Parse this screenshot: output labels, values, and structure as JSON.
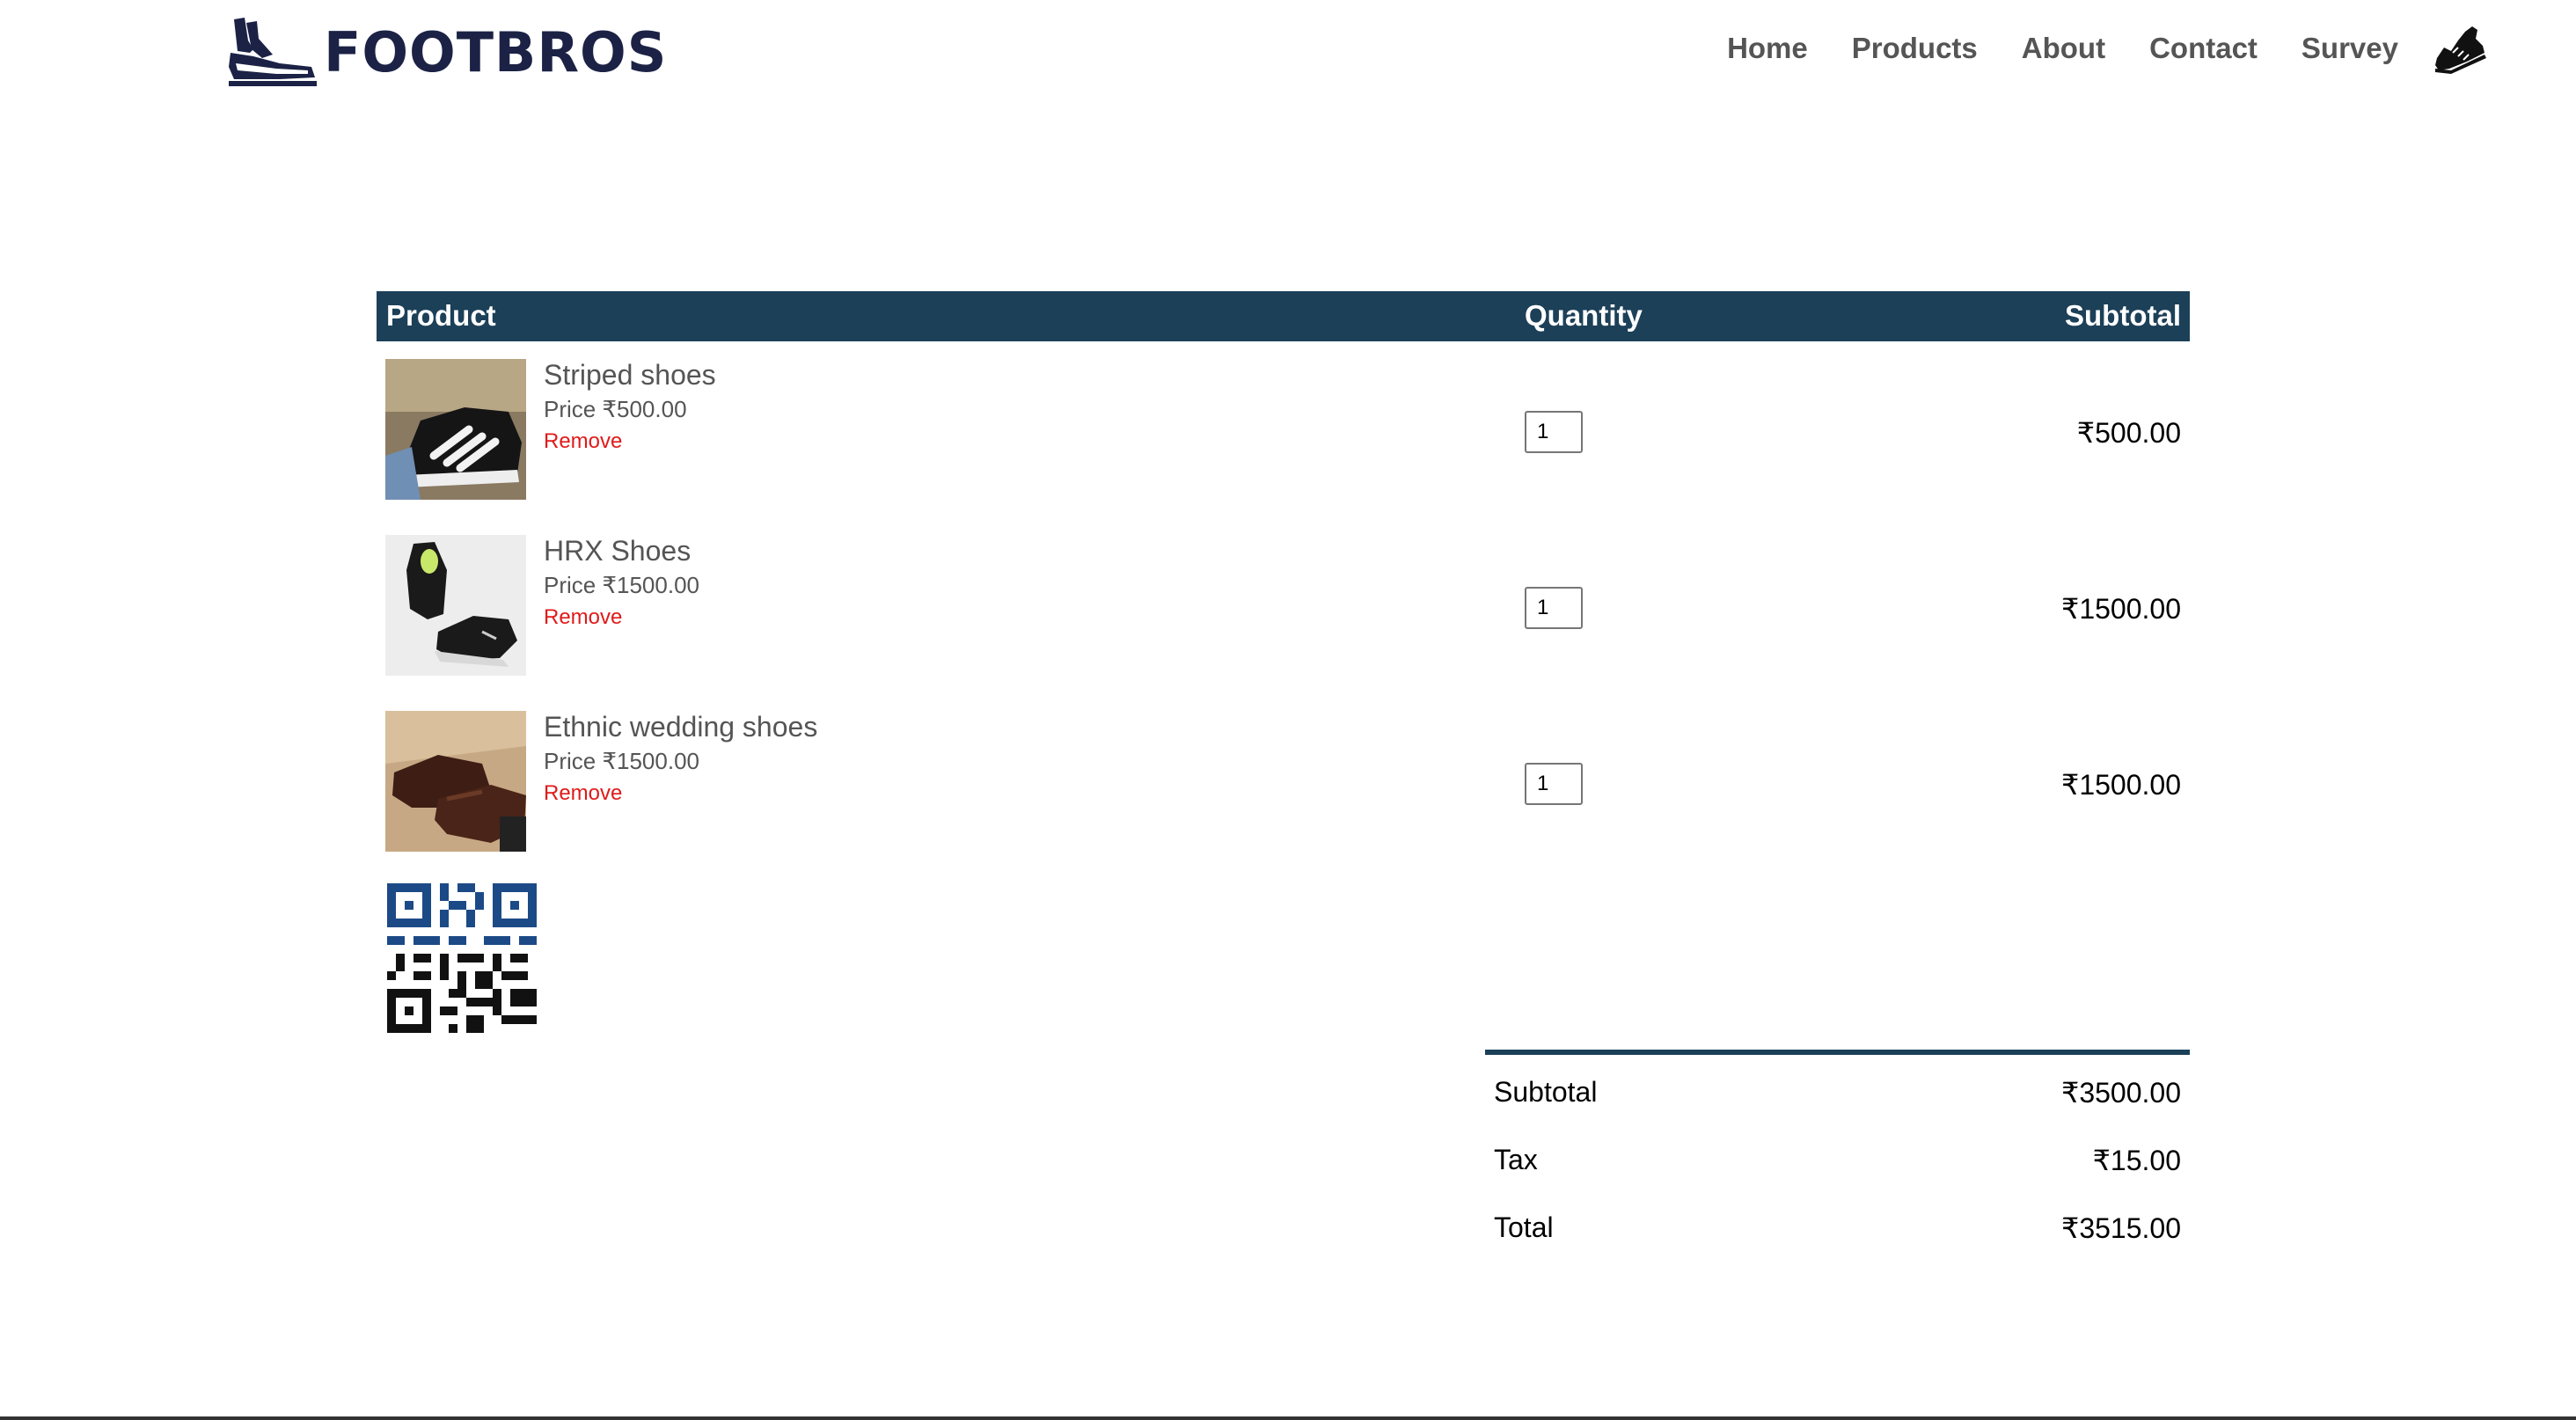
{
  "brand": {
    "name": "FOOTBROS",
    "color": "#1b2245"
  },
  "nav": {
    "items": [
      "Home",
      "Products",
      "About",
      "Contact",
      "Survey"
    ],
    "cart_icon": "shoe-icon"
  },
  "cart": {
    "headers": {
      "product": "Product",
      "quantity": "Quantity",
      "subtotal": "Subtotal"
    },
    "header_color": "#1c4058",
    "items": [
      {
        "name": "Striped shoes",
        "price": "Price ₹500.00",
        "remove": "Remove",
        "quantity": "1",
        "subtotal": "₹500.00"
      },
      {
        "name": "HRX Shoes",
        "price": "Price ₹1500.00",
        "remove": "Remove",
        "quantity": "1",
        "subtotal": "₹1500.00"
      },
      {
        "name": "Ethnic wedding shoes",
        "price": "Price ₹1500.00",
        "remove": "Remove",
        "quantity": "1",
        "subtotal": "₹1500.00"
      }
    ],
    "remove_color": "#e01a1a"
  },
  "totals": {
    "subtotal_label": "Subtotal",
    "subtotal_value": "₹3500.00",
    "tax_label": "Tax",
    "tax_value": "₹15.00",
    "total_label": "Total",
    "total_value": "₹3515.00"
  }
}
